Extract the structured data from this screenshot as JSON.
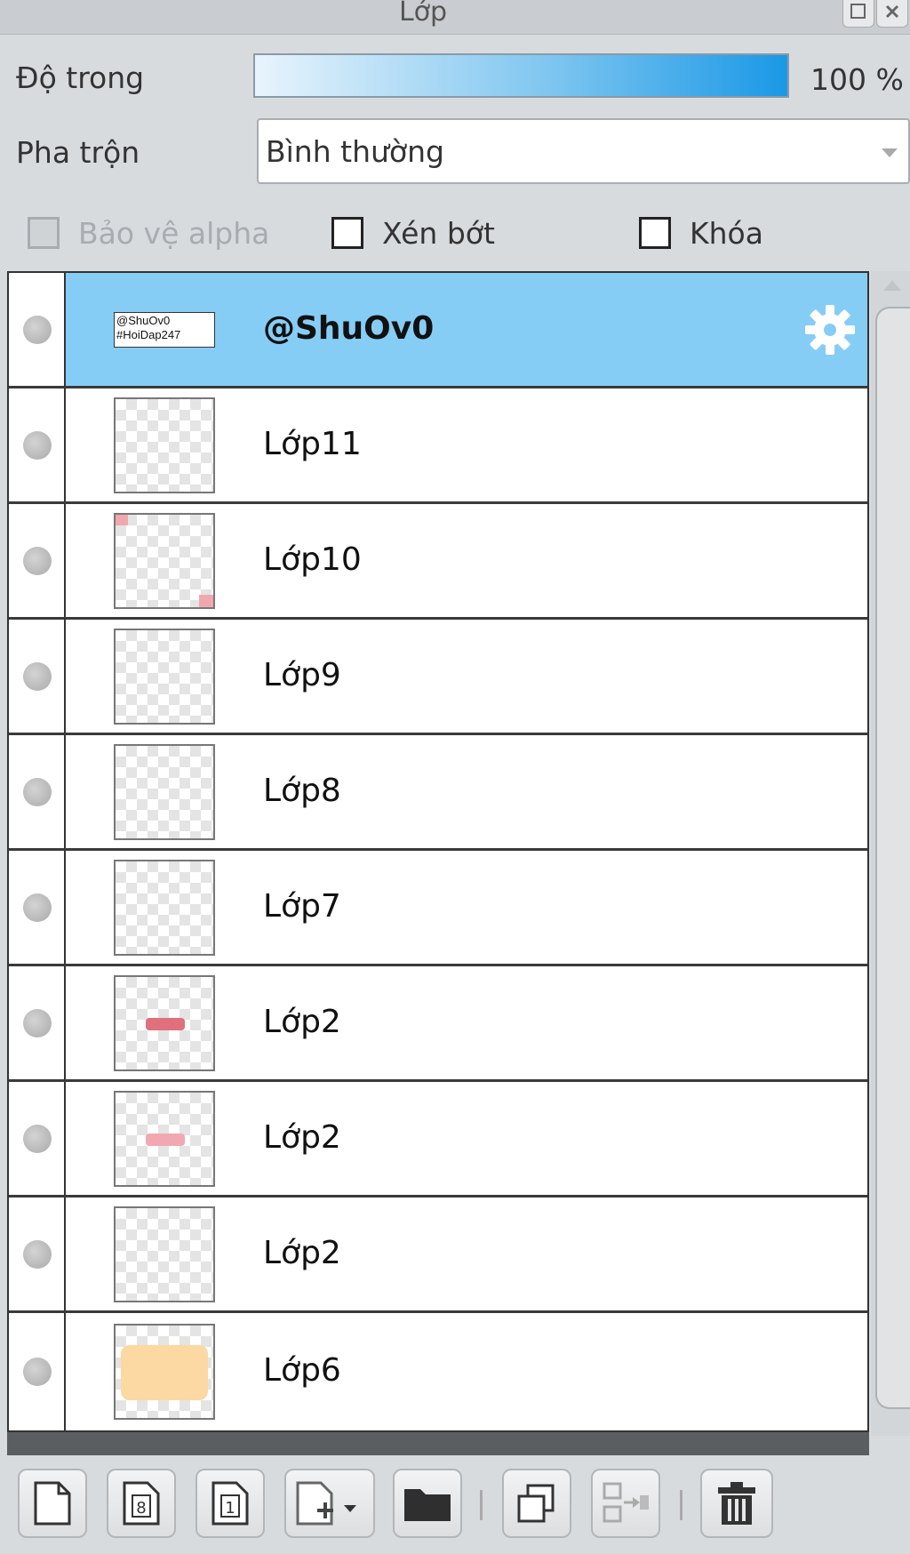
{
  "panel": {
    "title": "Lớp"
  },
  "opacity": {
    "label": "Độ trong",
    "value_text": "100 %",
    "value": 100
  },
  "blend": {
    "label": "Pha trộn",
    "selected": "Bình thường"
  },
  "options": {
    "protect_alpha": {
      "label": "Bảo vệ alpha",
      "checked": false,
      "disabled": true
    },
    "clipping": {
      "label": "Xén bớt",
      "checked": false
    },
    "lock": {
      "label": "Khóa",
      "checked": false
    }
  },
  "layers": [
    {
      "name": "@ShuOv0",
      "selected": true,
      "thumb_text": [
        "@ShuOv0",
        "#HoiDap247"
      ],
      "icon": "gear-icon"
    },
    {
      "name": "Lớp11"
    },
    {
      "name": "Lớp10"
    },
    {
      "name": "Lớp9"
    },
    {
      "name": "Lớp8"
    },
    {
      "name": "Lớp7"
    },
    {
      "name": "Lớp2"
    },
    {
      "name": "Lớp2"
    },
    {
      "name": "Lớp2"
    },
    {
      "name": "Lớp6"
    }
  ],
  "toolbar": {
    "buttons": [
      "new-layer-icon",
      "new-8bit-layer-icon",
      "new-1bit-layer-icon",
      "add-layer-dropdown-icon",
      "new-folder-icon",
      "duplicate-layer-icon",
      "merge-down-icon",
      "delete-layer-icon"
    ]
  },
  "colors": {
    "selected_row": "#86cdf6",
    "opacity_fill": "#1a98e6",
    "panel_bg": "#d8dbde"
  }
}
